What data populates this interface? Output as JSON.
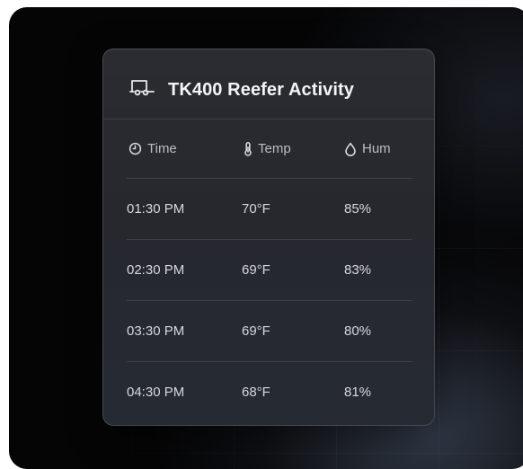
{
  "card": {
    "title": "TK400 Reefer Activity",
    "icon": "trailer-icon"
  },
  "table": {
    "columns": [
      {
        "label": "Time",
        "icon": "clock-icon"
      },
      {
        "label": "Temp",
        "icon": "thermometer-icon"
      },
      {
        "label": "Hum",
        "icon": "droplet-icon"
      }
    ],
    "rows": [
      {
        "time": "01:30 PM",
        "temp": "70°F",
        "hum": "85%"
      },
      {
        "time": "02:30 PM",
        "temp": "69°F",
        "hum": "83%"
      },
      {
        "time": "03:30 PM",
        "temp": "69°F",
        "hum": "80%"
      },
      {
        "time": "04:30 PM",
        "temp": "68°F",
        "hum": "81%"
      }
    ]
  }
}
